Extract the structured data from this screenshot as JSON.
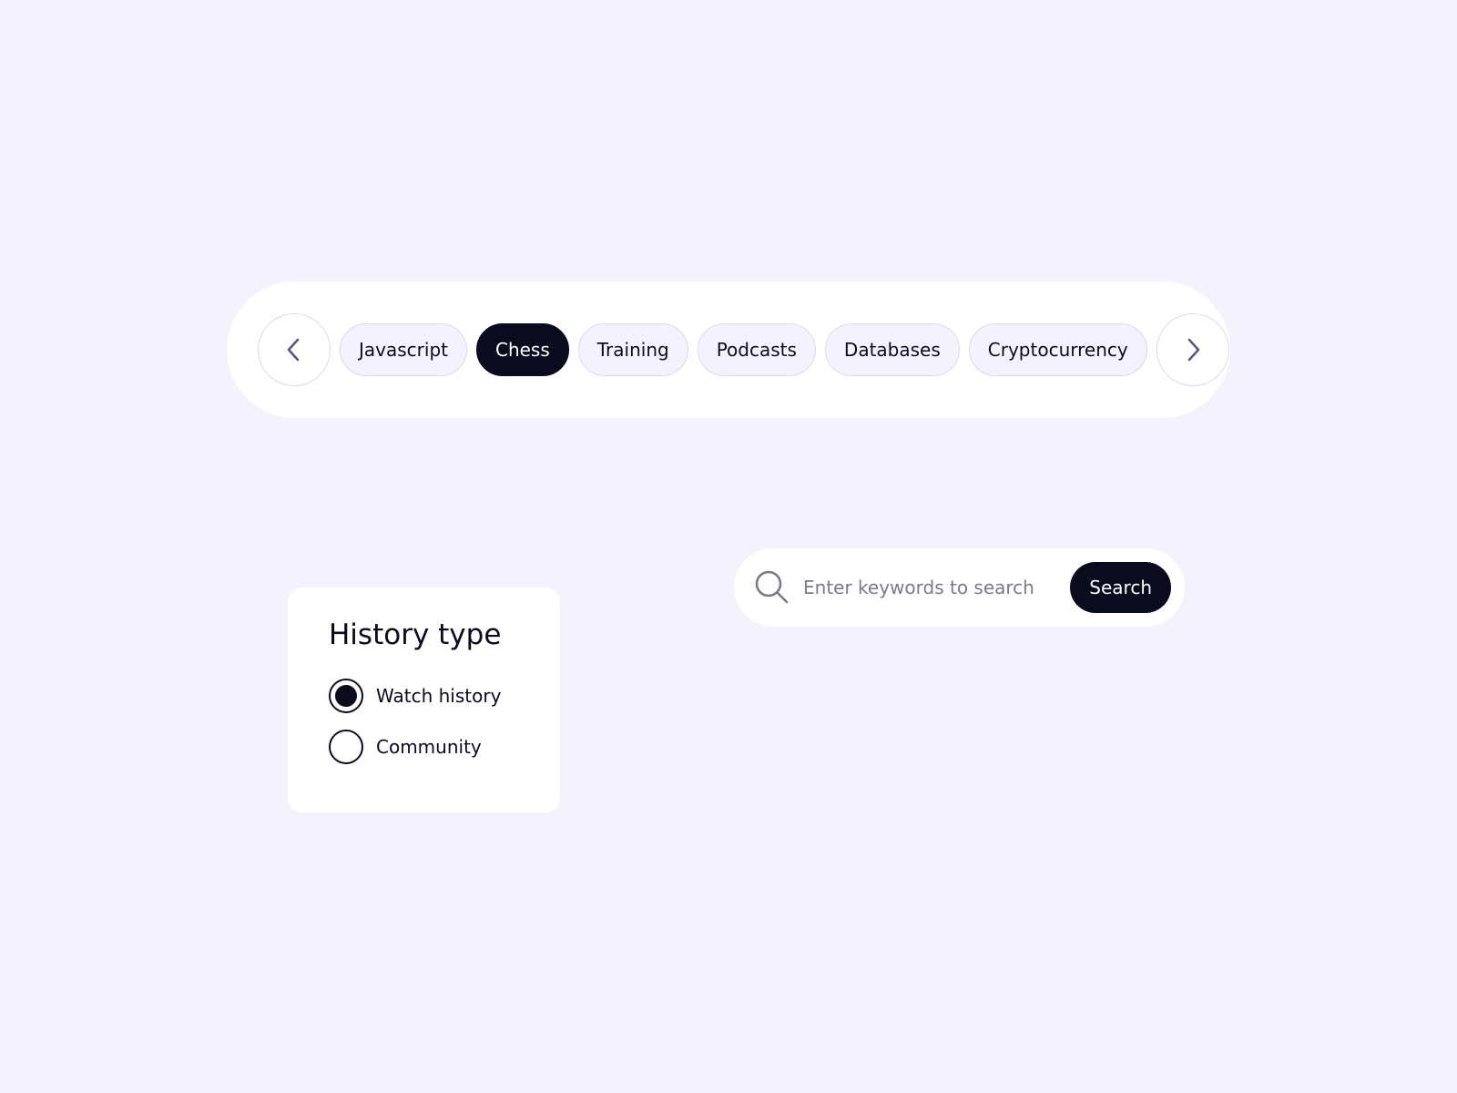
{
  "colors": {
    "background": "#f4f3fd",
    "surface": "#ffffff",
    "ink": "#0b0b1e",
    "chip_fill": "#f4f3fd",
    "chip_border": "#dcd9ef",
    "arrow": "#5a5882",
    "placeholder": "#7b7a88"
  },
  "chip_bar": {
    "prev_icon": "chevron-left-icon",
    "next_icon": "chevron-right-icon",
    "chips": [
      {
        "label": "Javascript",
        "selected": false
      },
      {
        "label": "Chess",
        "selected": true
      },
      {
        "label": "Training",
        "selected": false
      },
      {
        "label": "Podcasts",
        "selected": false
      },
      {
        "label": "Databases",
        "selected": false
      },
      {
        "label": "Cryptocurrency",
        "selected": false
      }
    ]
  },
  "history": {
    "title": "History type",
    "options": [
      {
        "label": "Watch history",
        "checked": true
      },
      {
        "label": "Community",
        "checked": false
      }
    ]
  },
  "search": {
    "icon": "search-icon",
    "value": "",
    "placeholder": "Enter keywords to search",
    "button_label": "Search"
  }
}
